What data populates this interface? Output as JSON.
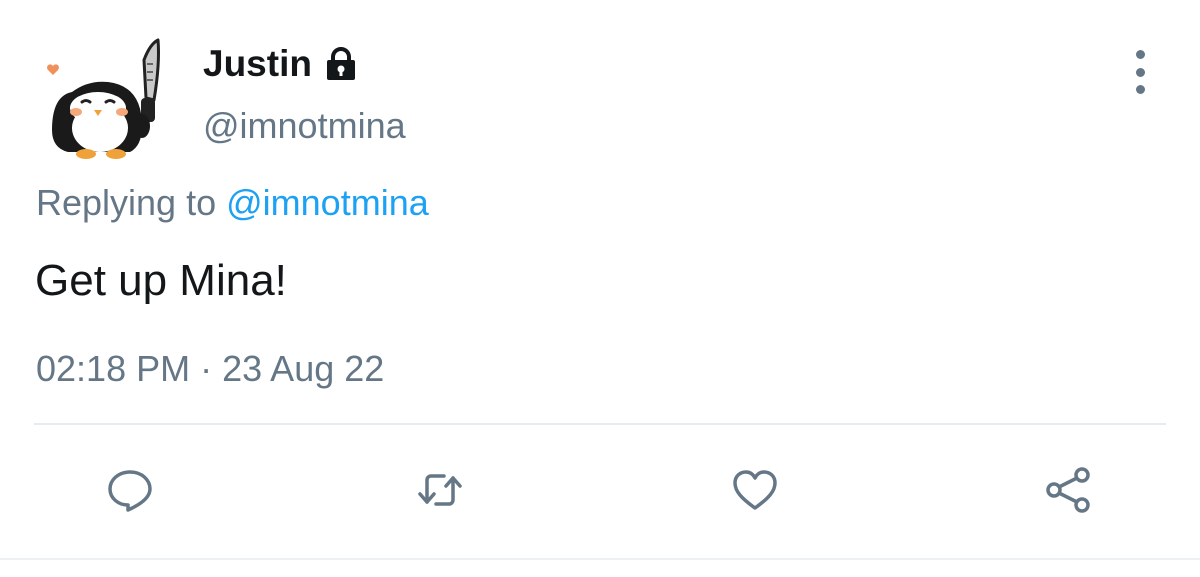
{
  "author": {
    "display_name": "Justin",
    "handle": "@imnotmina",
    "protected_icon": "lock-icon",
    "avatar": "penguin-with-knife-avatar"
  },
  "reply": {
    "prefix": "Replying to",
    "mention": "@imnotmina"
  },
  "tweet": {
    "text": "Get up Mina!",
    "time": "02:18 PM",
    "separator": "·",
    "date": "23 Aug 22"
  },
  "actions": [
    {
      "name": "reply",
      "icon": "speech-bubble-icon"
    },
    {
      "name": "retweet",
      "icon": "retweet-icon"
    },
    {
      "name": "like",
      "icon": "heart-icon"
    },
    {
      "name": "share",
      "icon": "share-icon"
    }
  ],
  "more_menu_icon": "vertical-ellipsis-icon",
  "colors": {
    "text_primary": "#14171a",
    "text_secondary": "#657786",
    "link": "#1da1f2",
    "divider": "#e6ecf0"
  }
}
